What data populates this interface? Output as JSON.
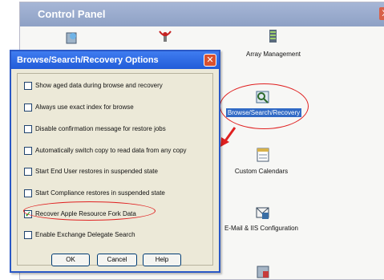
{
  "control_panel": {
    "title": "Control Panel",
    "close": "X",
    "items": [
      {
        "label": "Array Management",
        "icon": "array-icon"
      },
      {
        "label": "Browse/Search/Recovery",
        "icon": "browse-icon"
      },
      {
        "label": "Custom Calendars",
        "icon": "calendar-icon"
      },
      {
        "label": "E-Mail & IIS Configuration",
        "icon": "email-icon"
      }
    ]
  },
  "dialog": {
    "title": "Browse/Search/Recovery Options",
    "close": "✕",
    "options": [
      {
        "label": "Show aged data during browse and recovery",
        "checked": false
      },
      {
        "label": "Always use exact index for browse",
        "checked": false
      },
      {
        "label": "Disable confirmation message for restore jobs",
        "checked": false
      },
      {
        "label": "Automatically switch copy to read data from any copy",
        "checked": false
      },
      {
        "label": "Start End User restores in suspended state",
        "checked": false
      },
      {
        "label": "Start Compliance restores in suspended state",
        "checked": false
      },
      {
        "label": "Recover Apple Resource Fork Data",
        "checked": true
      },
      {
        "label": "Enable Exchange Delegate Search",
        "checked": false
      }
    ],
    "buttons": {
      "ok": "OK",
      "cancel": "Cancel",
      "help": "Help"
    }
  },
  "colors": {
    "annotation": "#e02020",
    "selection": "#316ac5",
    "title_bar": "#215cd8"
  }
}
